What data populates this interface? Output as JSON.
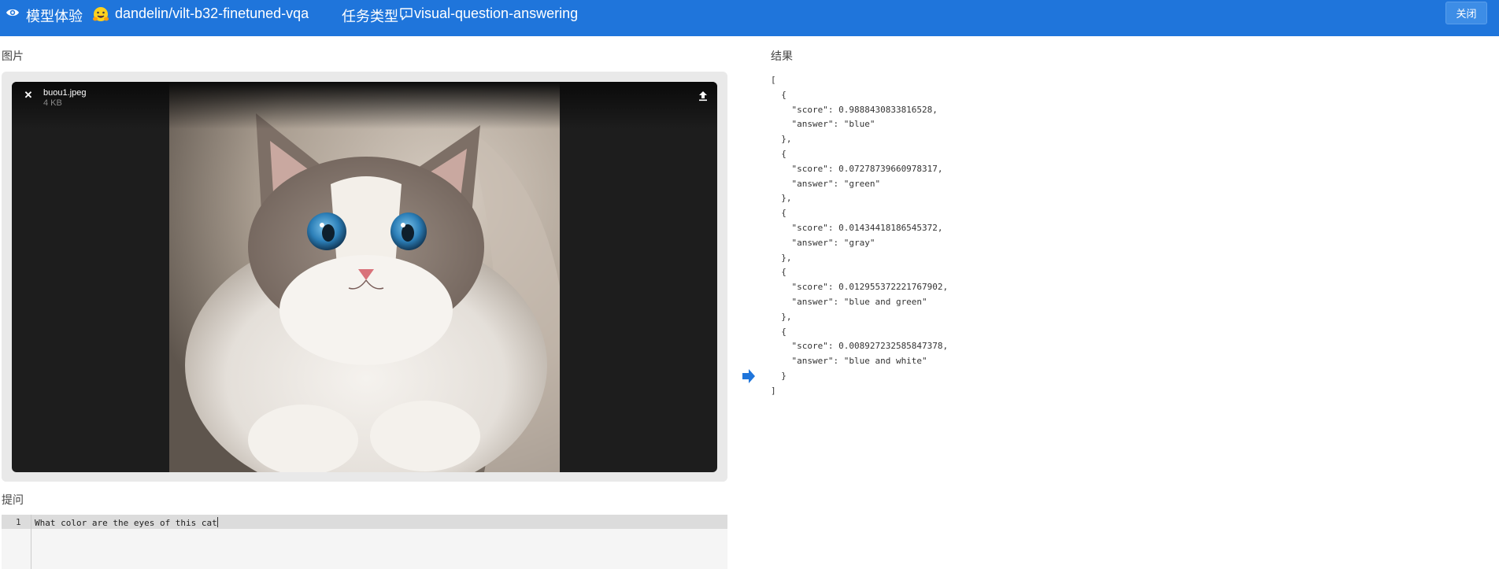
{
  "header": {
    "title": "模型体验",
    "model_name": "dandelin/vilt-b32-finetuned-vqa",
    "task_type_label": "任务类型",
    "task_name": "visual-question-answering",
    "close_label": "关闭"
  },
  "image_section": {
    "label": "图片",
    "file_name": "buou1.jpeg",
    "file_size": "4 KB"
  },
  "question_section": {
    "label": "提问",
    "line_number": "1",
    "question": "What color are the eyes of this cat"
  },
  "result_section": {
    "label": "结果",
    "open_bracket": "[",
    "close_bracket": "]",
    "items": [
      {
        "score": "0.9888430833816528",
        "answer": "blue"
      },
      {
        "score": "0.07278739660978317",
        "answer": "green"
      },
      {
        "score": "0.01434418186545372",
        "answer": "gray"
      },
      {
        "score": "0.012955372221767902",
        "answer": "blue and green"
      },
      {
        "score": "0.008927232585847378",
        "answer": "blue and white"
      }
    ]
  },
  "colors": {
    "header_bg": "#1f75db",
    "close_button_bg": "#3d8de6",
    "arrow": "#1f75db"
  },
  "icons": {
    "header_eye": "eye-icon",
    "model_emoji": "hugging-face-icon",
    "task_icon": "chat-bubble-icon",
    "file_remove": "close-icon",
    "file_upload": "upload-icon",
    "run_arrow": "arrow-right-icon"
  }
}
